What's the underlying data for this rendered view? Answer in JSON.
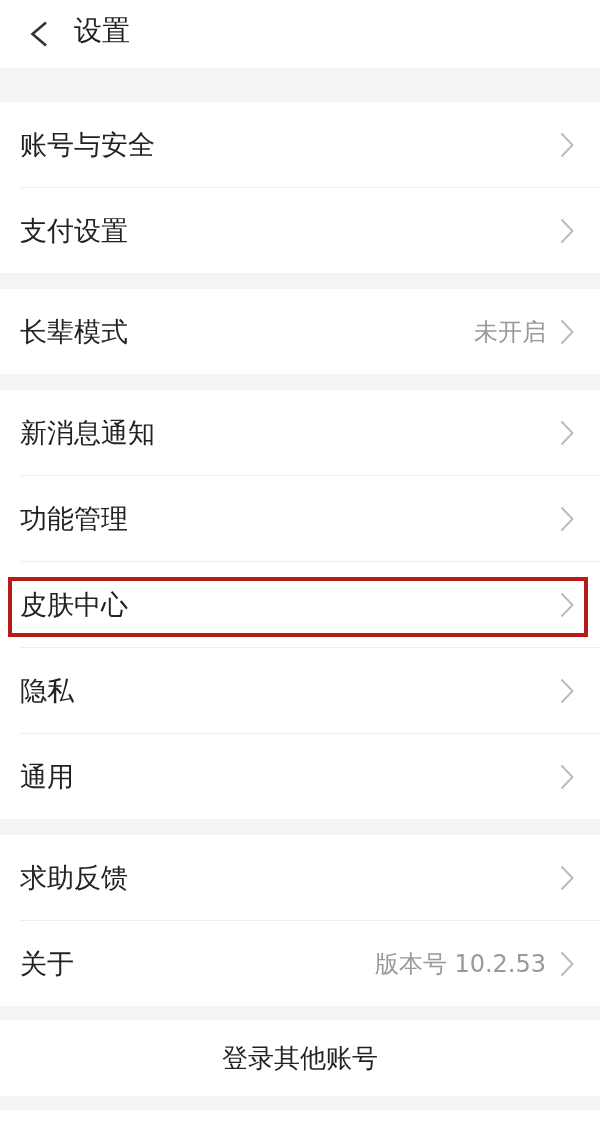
{
  "header": {
    "title": "设置"
  },
  "sections": [
    {
      "items": [
        {
          "label": "账号与安全",
          "highlighted": false
        },
        {
          "label": "支付设置",
          "highlighted": false
        }
      ]
    },
    {
      "items": [
        {
          "label": "长辈模式",
          "value": "未开启",
          "highlighted": false
        }
      ]
    },
    {
      "items": [
        {
          "label": "新消息通知",
          "highlighted": false
        },
        {
          "label": "功能管理",
          "highlighted": false
        },
        {
          "label": "皮肤中心",
          "highlighted": true
        },
        {
          "label": "隐私",
          "highlighted": false
        },
        {
          "label": "通用",
          "highlighted": false
        }
      ]
    },
    {
      "items": [
        {
          "label": "求助反馈",
          "highlighted": false
        },
        {
          "label": "关于",
          "value": "版本号 10.2.53",
          "highlighted": false
        }
      ]
    }
  ],
  "login_button": {
    "label": "登录其他账号"
  }
}
